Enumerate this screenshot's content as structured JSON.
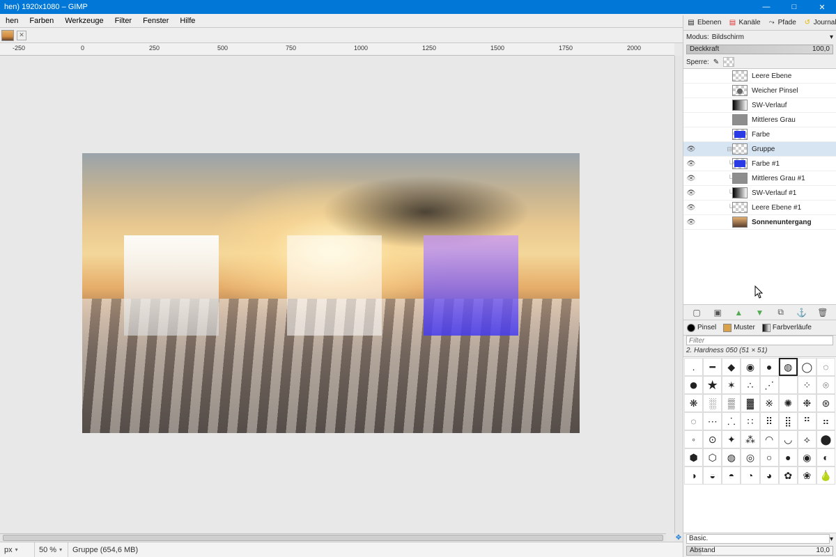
{
  "window": {
    "title_fragment": "hen) 1920x1080 – GIMP",
    "minimize": "—",
    "maximize": "□",
    "close": "✕"
  },
  "menu": {
    "items": [
      "Farben",
      "Werkzeuge",
      "Filter",
      "Fenster",
      "Hilfe"
    ],
    "leading_partial": "hen"
  },
  "ruler": {
    "labels": [
      "-250",
      "0",
      "250",
      "500",
      "750",
      "1000",
      "1250",
      "1500",
      "1750",
      "2000"
    ]
  },
  "statusbar": {
    "unit": "px",
    "zoom": "50 %",
    "layer_info": "Gruppe (654,6 MB)"
  },
  "dock_tabs": {
    "layers": "Ebenen",
    "channels": "Kanäle",
    "paths": "Pfade",
    "undo": "Journal"
  },
  "layers_panel": {
    "mode_label": "Modus:",
    "mode_value": "Bildschirm",
    "opacity_label": "Deckkraft",
    "opacity_value": "100,0",
    "lock_label": "Sperre:"
  },
  "layers": [
    {
      "name": "Leere Ebene",
      "indent": 1,
      "eye": false,
      "thumb": "empty"
    },
    {
      "name": "Weicher Pinsel",
      "indent": 1,
      "eye": false,
      "thumb": "dot"
    },
    {
      "name": "SW-Verlauf",
      "indent": 1,
      "eye": false,
      "thumb": "grad"
    },
    {
      "name": "Mittleres Grau",
      "indent": 1,
      "eye": false,
      "thumb": "gray"
    },
    {
      "name": "Farbe",
      "indent": 1,
      "eye": false,
      "thumb": "color"
    },
    {
      "name": "Gruppe",
      "indent": 0,
      "eye": true,
      "thumb": "empty",
      "group": true,
      "selected": true
    },
    {
      "name": "Farbe #1",
      "indent": 2,
      "eye": true,
      "thumb": "color"
    },
    {
      "name": "Mittleres Grau #1",
      "indent": 2,
      "eye": true,
      "thumb": "gray"
    },
    {
      "name": "SW-Verlauf #1",
      "indent": 2,
      "eye": true,
      "thumb": "grad"
    },
    {
      "name": "Leere Ebene #1",
      "indent": 2,
      "eye": true,
      "thumb": "empty"
    },
    {
      "name": "Sonnenuntergang",
      "indent": 1,
      "eye": true,
      "thumb": "fill",
      "bold": true
    }
  ],
  "layer_buttons": {
    "new": "new-layer",
    "group": "new-group",
    "up": "raise",
    "down": "lower",
    "dup": "duplicate",
    "anchor": "anchor",
    "delete": "delete"
  },
  "brush_tabs": {
    "brushes": "Pinsel",
    "patterns": "Muster",
    "gradients": "Farbverläufe"
  },
  "brush_panel": {
    "filter_placeholder": "Filter",
    "current": "2. Hardness 050 (51 × 51)",
    "preset": "Basic.",
    "spacing_label": "Abstand",
    "spacing_value": "10,0"
  },
  "canvas": {
    "image_dimensions": "1920x1080"
  }
}
